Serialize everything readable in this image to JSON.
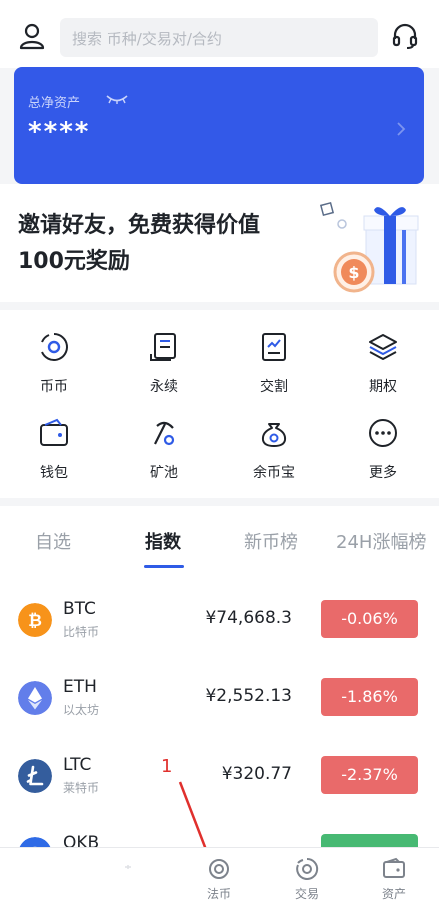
{
  "header": {
    "search_placeholder": "搜索 币种/交易对/合约",
    "user_icon": "user-icon",
    "support_icon": "headset-icon"
  },
  "asset_card": {
    "label": "总净资产",
    "value": "****",
    "color": "#3359e8"
  },
  "promo": {
    "text": "邀请好友，免费获得价值100元奖励"
  },
  "quick_menu": [
    {
      "label": "币币",
      "icon": "spot-icon"
    },
    {
      "label": "永续",
      "icon": "perpetual-icon"
    },
    {
      "label": "交割",
      "icon": "futures-icon"
    },
    {
      "label": "期权",
      "icon": "options-icon"
    },
    {
      "label": "钱包",
      "icon": "wallet-icon"
    },
    {
      "label": "矿池",
      "icon": "mining-pool-icon"
    },
    {
      "label": "余币宝",
      "icon": "savings-icon"
    },
    {
      "label": "更多",
      "icon": "more-icon"
    }
  ],
  "market_tabs": [
    {
      "label": "自选",
      "active": false
    },
    {
      "label": "指数",
      "active": true
    },
    {
      "label": "新币榜",
      "active": false
    },
    {
      "label": "24H涨幅榜",
      "active": false
    }
  ],
  "coins": [
    {
      "symbol": "BTC",
      "name": "比特币",
      "price": "¥74,668.3",
      "change": "-0.06%",
      "color": "#f7931a"
    },
    {
      "symbol": "ETH",
      "name": "以太坊",
      "price": "¥2,552.13",
      "change": "-1.86%",
      "color": "#627eea"
    },
    {
      "symbol": "LTC",
      "name": "莱特币",
      "price": "¥320.77",
      "change": "-2.37%",
      "color": "#345d9d"
    },
    {
      "symbol": "OKB",
      "name": "",
      "price": "",
      "change": "",
      "color": "#2f6be6"
    }
  ],
  "colors": {
    "down": "#e96a6a",
    "up": "#47b973",
    "accent": "#2f5be6"
  },
  "annotation": {
    "number": "1"
  },
  "bottom_nav": [
    {
      "label": "",
      "icon": "home-icon"
    },
    {
      "label": "法币",
      "icon": "fiat-icon"
    },
    {
      "label": "交易",
      "icon": "trade-icon"
    },
    {
      "label": "资产",
      "icon": "assets-icon"
    }
  ]
}
